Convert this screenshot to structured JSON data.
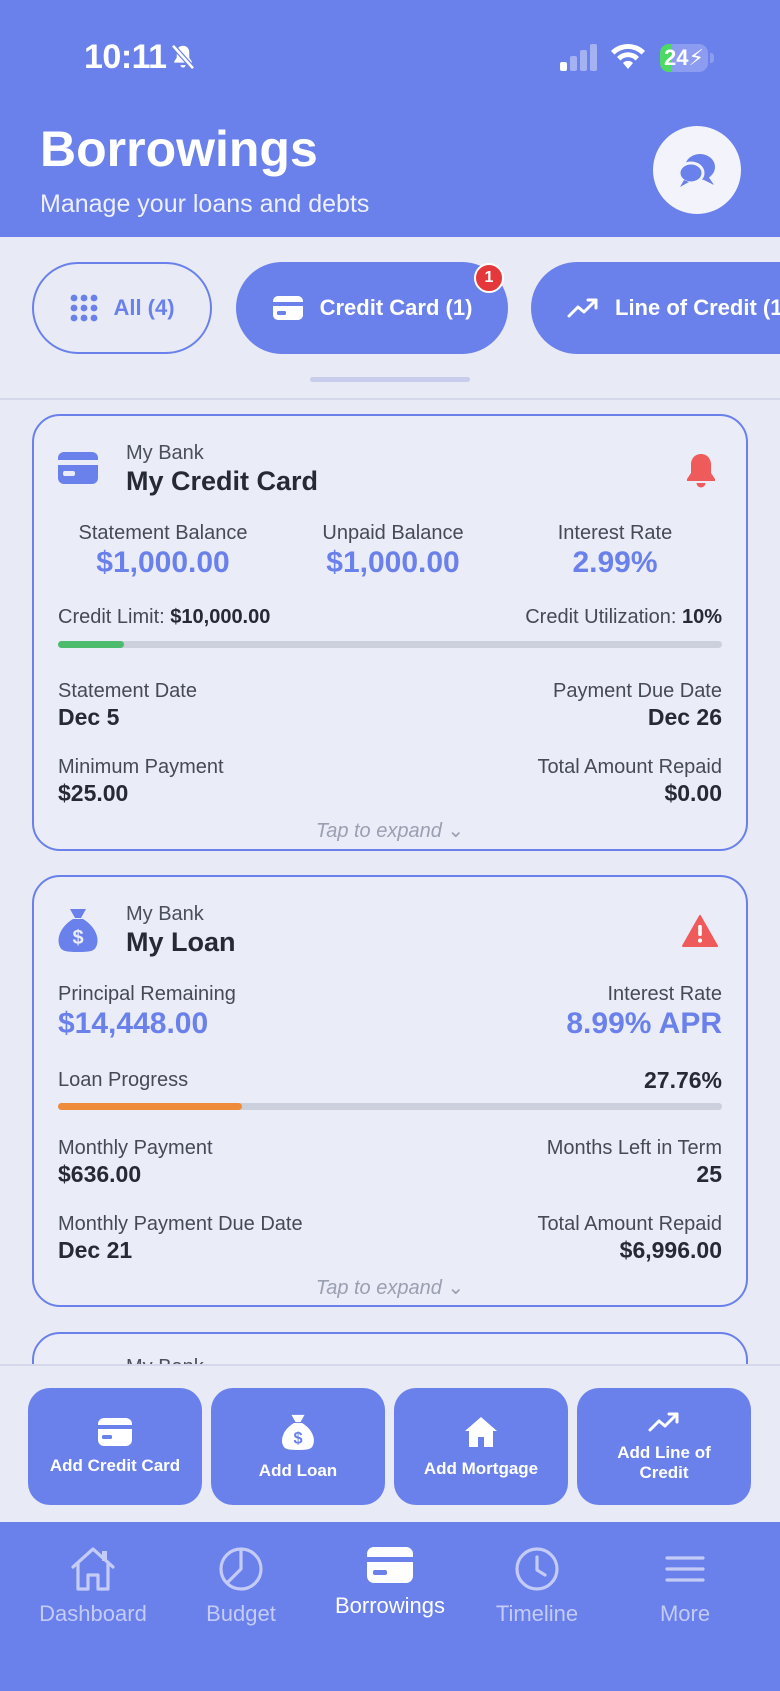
{
  "status": {
    "time": "10:11",
    "battery": "24",
    "battery_level": 0.24
  },
  "header": {
    "title": "Borrowings",
    "subtitle": "Manage your loans and debts"
  },
  "filters": [
    {
      "label": "All (4)",
      "icon": "grid-icon"
    },
    {
      "label": "Credit Card (1)",
      "icon": "credit-card-icon",
      "badge": "1"
    },
    {
      "label": "Line of Credit (1",
      "icon": "trending-up-icon"
    }
  ],
  "credit_card": {
    "bank": "My Bank",
    "name": "My Credit Card",
    "statement_balance_label": "Statement Balance",
    "statement_balance": "$1,000.00",
    "unpaid_balance_label": "Unpaid Balance",
    "unpaid_balance": "$1,000.00",
    "interest_rate_label": "Interest Rate",
    "interest_rate": "2.99%",
    "credit_limit_label": "Credit Limit:",
    "credit_limit": "$10,000.00",
    "utilization_label": "Credit Utilization:",
    "utilization": "10%",
    "utilization_fraction": 0.1,
    "statement_date_label": "Statement Date",
    "statement_date": "Dec 5",
    "payment_due_label": "Payment Due Date",
    "payment_due": "Dec 26",
    "min_payment_label": "Minimum Payment",
    "min_payment": "$25.00",
    "total_repaid_label": "Total Amount Repaid",
    "total_repaid": "$0.00",
    "expand": "Tap to expand"
  },
  "loan": {
    "bank": "My Bank",
    "name": "My Loan",
    "principal_label": "Principal Remaining",
    "principal": "$14,448.00",
    "interest_rate_label": "Interest Rate",
    "interest_rate": "8.99% APR",
    "progress_label": "Loan Progress",
    "progress": "27.76%",
    "progress_fraction": 0.2776,
    "monthly_payment_label": "Monthly Payment",
    "monthly_payment": "$636.00",
    "months_left_label": "Months Left in Term",
    "months_left": "25",
    "due_date_label": "Monthly Payment Due Date",
    "due_date": "Dec 21",
    "total_repaid_label": "Total Amount Repaid",
    "total_repaid": "$6,996.00",
    "expand": "Tap to expand"
  },
  "peek_card": {
    "bank": "My Bank"
  },
  "actions": [
    {
      "label": "Add Credit Card",
      "icon": "credit-card-icon"
    },
    {
      "label": "Add Loan",
      "icon": "money-bag-icon"
    },
    {
      "label": "Add Mortgage",
      "icon": "home-icon"
    },
    {
      "label": "Add Line of Credit",
      "icon": "trending-up-icon"
    }
  ],
  "tabs": [
    {
      "label": "Dashboard",
      "icon": "home-icon"
    },
    {
      "label": "Budget",
      "icon": "pie-chart-icon"
    },
    {
      "label": "Borrowings",
      "icon": "credit-card-icon",
      "active": true
    },
    {
      "label": "Timeline",
      "icon": "clock-icon"
    },
    {
      "label": "More",
      "icon": "menu-icon"
    }
  ],
  "colors": {
    "primary": "#6a80ea",
    "green": "#4cbb6b",
    "orange": "#ef8c3b",
    "alert": "#ef5b5b"
  }
}
